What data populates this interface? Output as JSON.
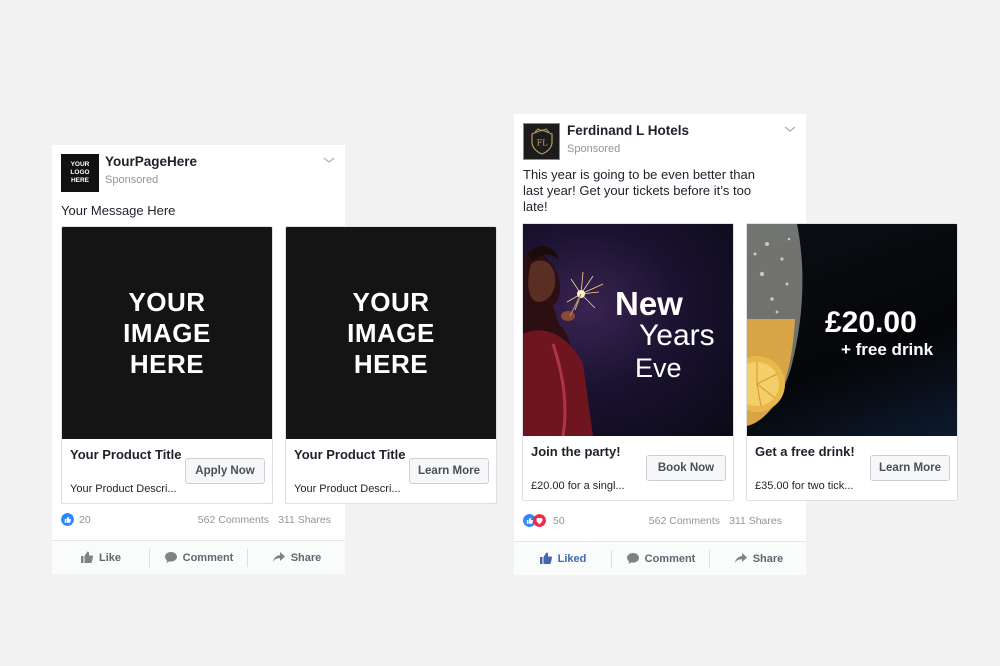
{
  "post1": {
    "logo_lines": [
      "YOUR",
      "LOGO",
      "HERE"
    ],
    "page_name": "YourPageHere",
    "sponsored": "Sponsored",
    "message": "Your Message Here",
    "cards": [
      {
        "image_lines": [
          "YOUR",
          "IMAGE",
          "HERE"
        ],
        "title": "Your Product Title",
        "description": "Your Product Descri...",
        "cta": "Apply Now"
      },
      {
        "image_lines": [
          "YOUR",
          "IMAGE",
          "HERE"
        ],
        "title": "Your Product Title",
        "description": "Your Product Descri...",
        "cta": "Learn More"
      }
    ],
    "reactions": "20",
    "comments": "562 Comments",
    "shares": "311 Shares",
    "actions": {
      "like": "Like",
      "comment": "Comment",
      "share": "Share"
    }
  },
  "post2": {
    "logo_monogram": "FL",
    "page_name": "Ferdinand L Hotels",
    "sponsored": "Sponsored",
    "message": "This year is going to be even better than last year! Get your tickets before it’s too late!",
    "cards": [
      {
        "image_lines": [
          "New",
          "Years",
          "Eve"
        ],
        "title": "Join the party!",
        "description": "£20.00 for a singl...",
        "cta": "Book Now"
      },
      {
        "image_lines": [
          "£20.00",
          "+ free drink"
        ],
        "title": "Get a free  drink!",
        "description": "£35.00 for two tick...",
        "cta": "Learn More"
      }
    ],
    "reactions": "50",
    "comments": "562 Comments",
    "shares": "311 Shares",
    "actions": {
      "like": "Liked",
      "comment": "Comment",
      "share": "Share"
    }
  },
  "colors": {
    "background": "#f2f2f2",
    "facebook_blue": "#4267b2",
    "like_blue": "#2d88ff",
    "love_red": "#f0284a",
    "muted_text": "#90949c",
    "image_dark": "#141414"
  },
  "icons": [
    "chevron-down-icon",
    "like-reaction-icon",
    "love-reaction-icon",
    "thumbs-up-icon",
    "comment-icon",
    "share-icon"
  ]
}
